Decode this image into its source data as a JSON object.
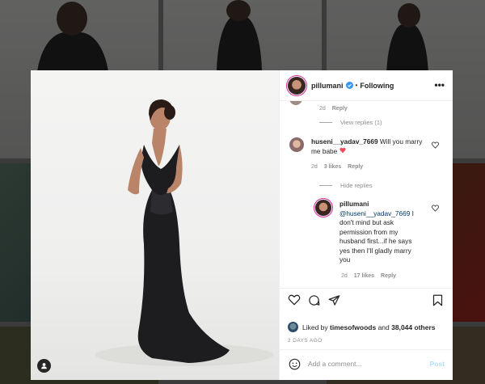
{
  "post": {
    "username": "pillumani",
    "follow_status": "Following",
    "more_label": "•••"
  },
  "comments": {
    "prev_meta": {
      "time": "2d",
      "reply": "Reply"
    },
    "view_replies": "View replies (1)",
    "comment1": {
      "username": "huseni__yadav_7669",
      "text": "Will you marry me babe",
      "emoji": "❤️",
      "time": "2d",
      "likes": "3 likes",
      "reply": "Reply"
    },
    "hide_replies": "Hide replies",
    "reply1": {
      "username": "pillumani",
      "mention": "@huseni__yadav_7669",
      "text": "I don't mind but ask permission from my husband first...if he says yes then I'll gladly marry you",
      "time": "2d",
      "likes": "17 likes",
      "reply": "Reply"
    }
  },
  "likes": {
    "prefix": "Liked by",
    "user": "timesofwoods",
    "conj": "and",
    "count": "38,044 others"
  },
  "date": "2 DAYS AGO",
  "add_comment": {
    "placeholder": "Add a comment...",
    "post_label": "Post"
  },
  "colors": {
    "verified": "#3897f0",
    "heart_red": "#ed4956",
    "link": "#00376b",
    "post_disabled": "#b2dffc"
  },
  "icons": [
    "verified-badge-icon",
    "heart-icon",
    "comment-icon",
    "share-icon",
    "bookmark-icon",
    "emoji-icon",
    "user-tag-icon"
  ]
}
